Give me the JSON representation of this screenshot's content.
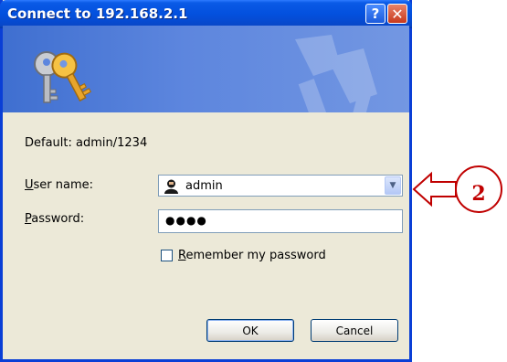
{
  "window": {
    "title": "Connect to 192.168.2.1",
    "help_label": "?",
    "close_label": "✕"
  },
  "banner": {
    "icon": "keys-icon"
  },
  "hint": "Default: admin/1234",
  "username": {
    "label_access": "U",
    "label_rest": "ser name:",
    "value": "admin",
    "icon": "user-icon"
  },
  "password": {
    "label_access": "P",
    "label_rest": "assword:",
    "value": "●●●●"
  },
  "remember": {
    "label_access": "R",
    "label_rest": "emember my password",
    "checked": false
  },
  "buttons": {
    "ok": "OK",
    "cancel": "Cancel"
  },
  "annotation": {
    "number": "2",
    "color": "#c00000"
  }
}
